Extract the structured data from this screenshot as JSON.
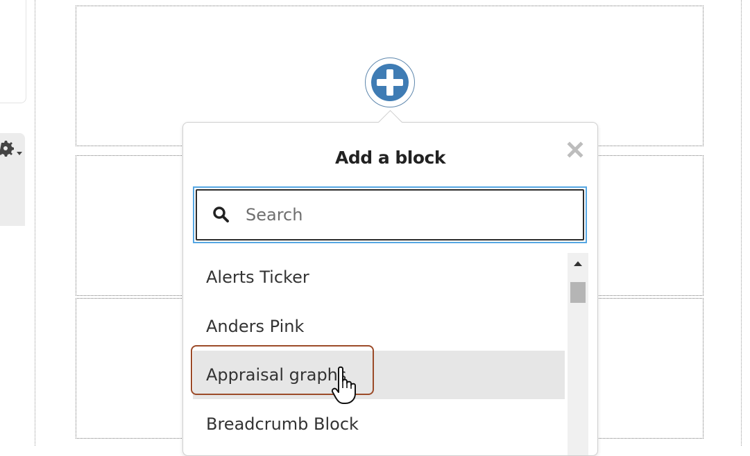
{
  "popover": {
    "title": "Add a block",
    "search": {
      "placeholder": "Search",
      "value": ""
    },
    "items": [
      {
        "label": "Alerts Ticker"
      },
      {
        "label": "Anders Pink"
      },
      {
        "label": "Appraisal graphs"
      },
      {
        "label": "Breadcrumb Block"
      }
    ]
  },
  "colors": {
    "accent": "#3f7cb4",
    "search_focus": "#55a6e3",
    "highlight": "#9b4a28",
    "hover_bg": "#e6e6e6"
  }
}
